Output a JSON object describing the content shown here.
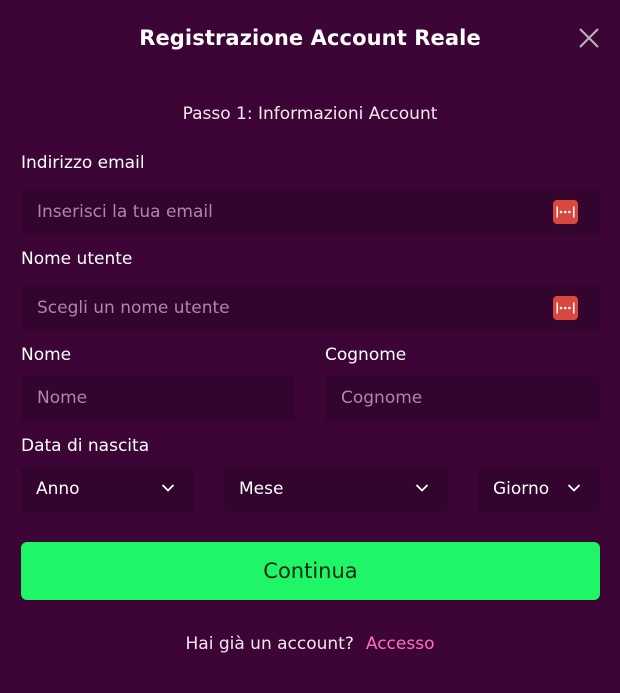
{
  "modal": {
    "title": "Registrazione Account Reale",
    "step": "Passo 1: Informazioni Account"
  },
  "email": {
    "label": "Indirizzo email",
    "placeholder": "Inserisci la tua email",
    "value": ""
  },
  "username": {
    "label": "Nome utente",
    "placeholder": "Scegli un nome utente",
    "value": ""
  },
  "first_name": {
    "label": "Nome",
    "placeholder": "Nome",
    "value": ""
  },
  "last_name": {
    "label": "Cognome",
    "placeholder": "Cognome",
    "value": ""
  },
  "birthdate": {
    "label": "Data di nascita",
    "year": "Anno",
    "month": "Mese",
    "day": "Giorno"
  },
  "continue_label": "Continua",
  "footer": {
    "question": "Hai già un account?",
    "link": "Accesso"
  },
  "icons": {
    "close": "close-icon",
    "password_manager": "password-manager-icon",
    "chevron": "chevron-down-icon"
  },
  "colors": {
    "background": "#3d0535",
    "input_bg": "#33042d",
    "accent_green": "#1ff566",
    "link_pink": "#ff6fc6",
    "password_icon": "#d9473f"
  }
}
